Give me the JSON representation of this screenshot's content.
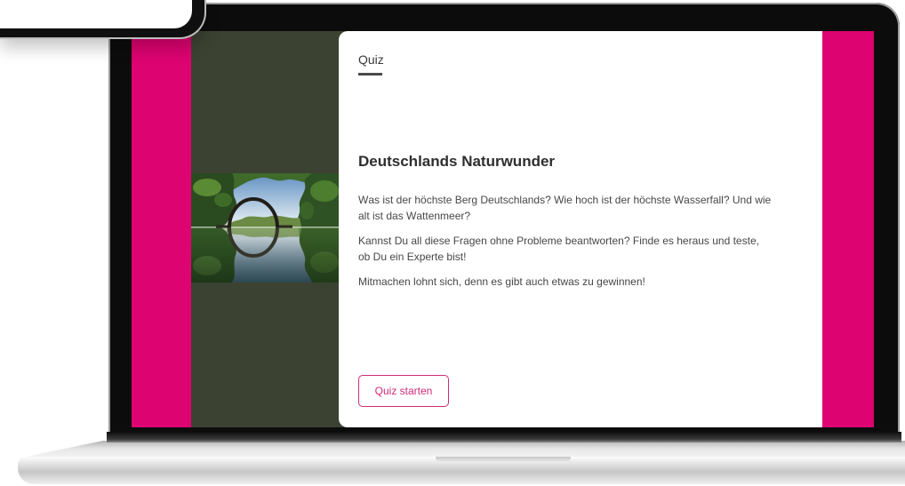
{
  "quiz": {
    "label": "Quiz",
    "title": "Deutschlands Naturwunder",
    "paragraphs": [
      "Was ist der höchste Berg Deutschlands? Wie hoch ist der höchste Wasserfall? Und wie alt ist das Wattenmeer?",
      "Kannst Du all diese Fragen ohne Probleme beantworten? Finde es heraus und teste, ob Du ein Experte bist!",
      "Mitmachen lohnt sich, denn es gibt auch etwas zu gewinnen!"
    ],
    "start_button_label": "Quiz starten"
  },
  "colors": {
    "accent": "#dd0370",
    "side_panel": "#3c4232",
    "card_background": "#ffffff",
    "button_text": "#d02b77"
  }
}
